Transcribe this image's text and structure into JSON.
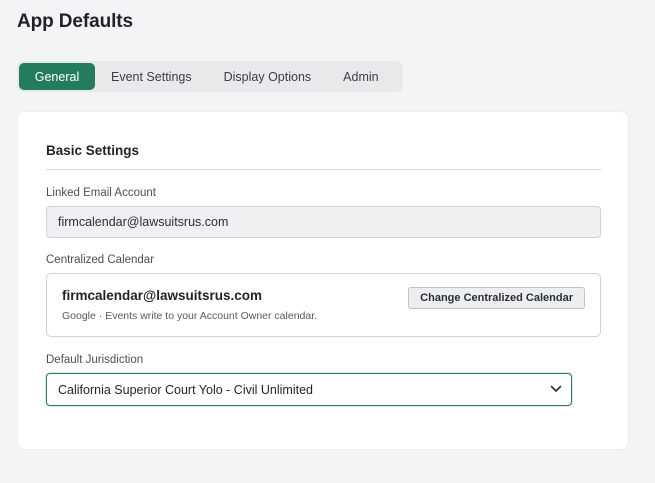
{
  "page": {
    "title": "App Defaults"
  },
  "tabs": [
    {
      "label": "General",
      "active": true
    },
    {
      "label": "Event Settings",
      "active": false
    },
    {
      "label": "Display Options",
      "active": false
    },
    {
      "label": "Admin",
      "active": false
    }
  ],
  "basic_settings": {
    "title": "Basic Settings",
    "linked_email": {
      "label": "Linked Email Account",
      "value": "firmcalendar@lawsuitsrus.com"
    },
    "centralized_calendar": {
      "label": "Centralized Calendar",
      "email": "firmcalendar@lawsuitsrus.com",
      "description": "Google · Events write to your Account Owner calendar.",
      "change_button": "Change Centralized Calendar"
    },
    "default_jurisdiction": {
      "label": "Default Jurisdiction",
      "selected": "California Superior Court Yolo - Civil Unlimited"
    }
  },
  "colors": {
    "accent": "#237c5b",
    "background": "#f3f4f6",
    "card": "#ffffff"
  }
}
